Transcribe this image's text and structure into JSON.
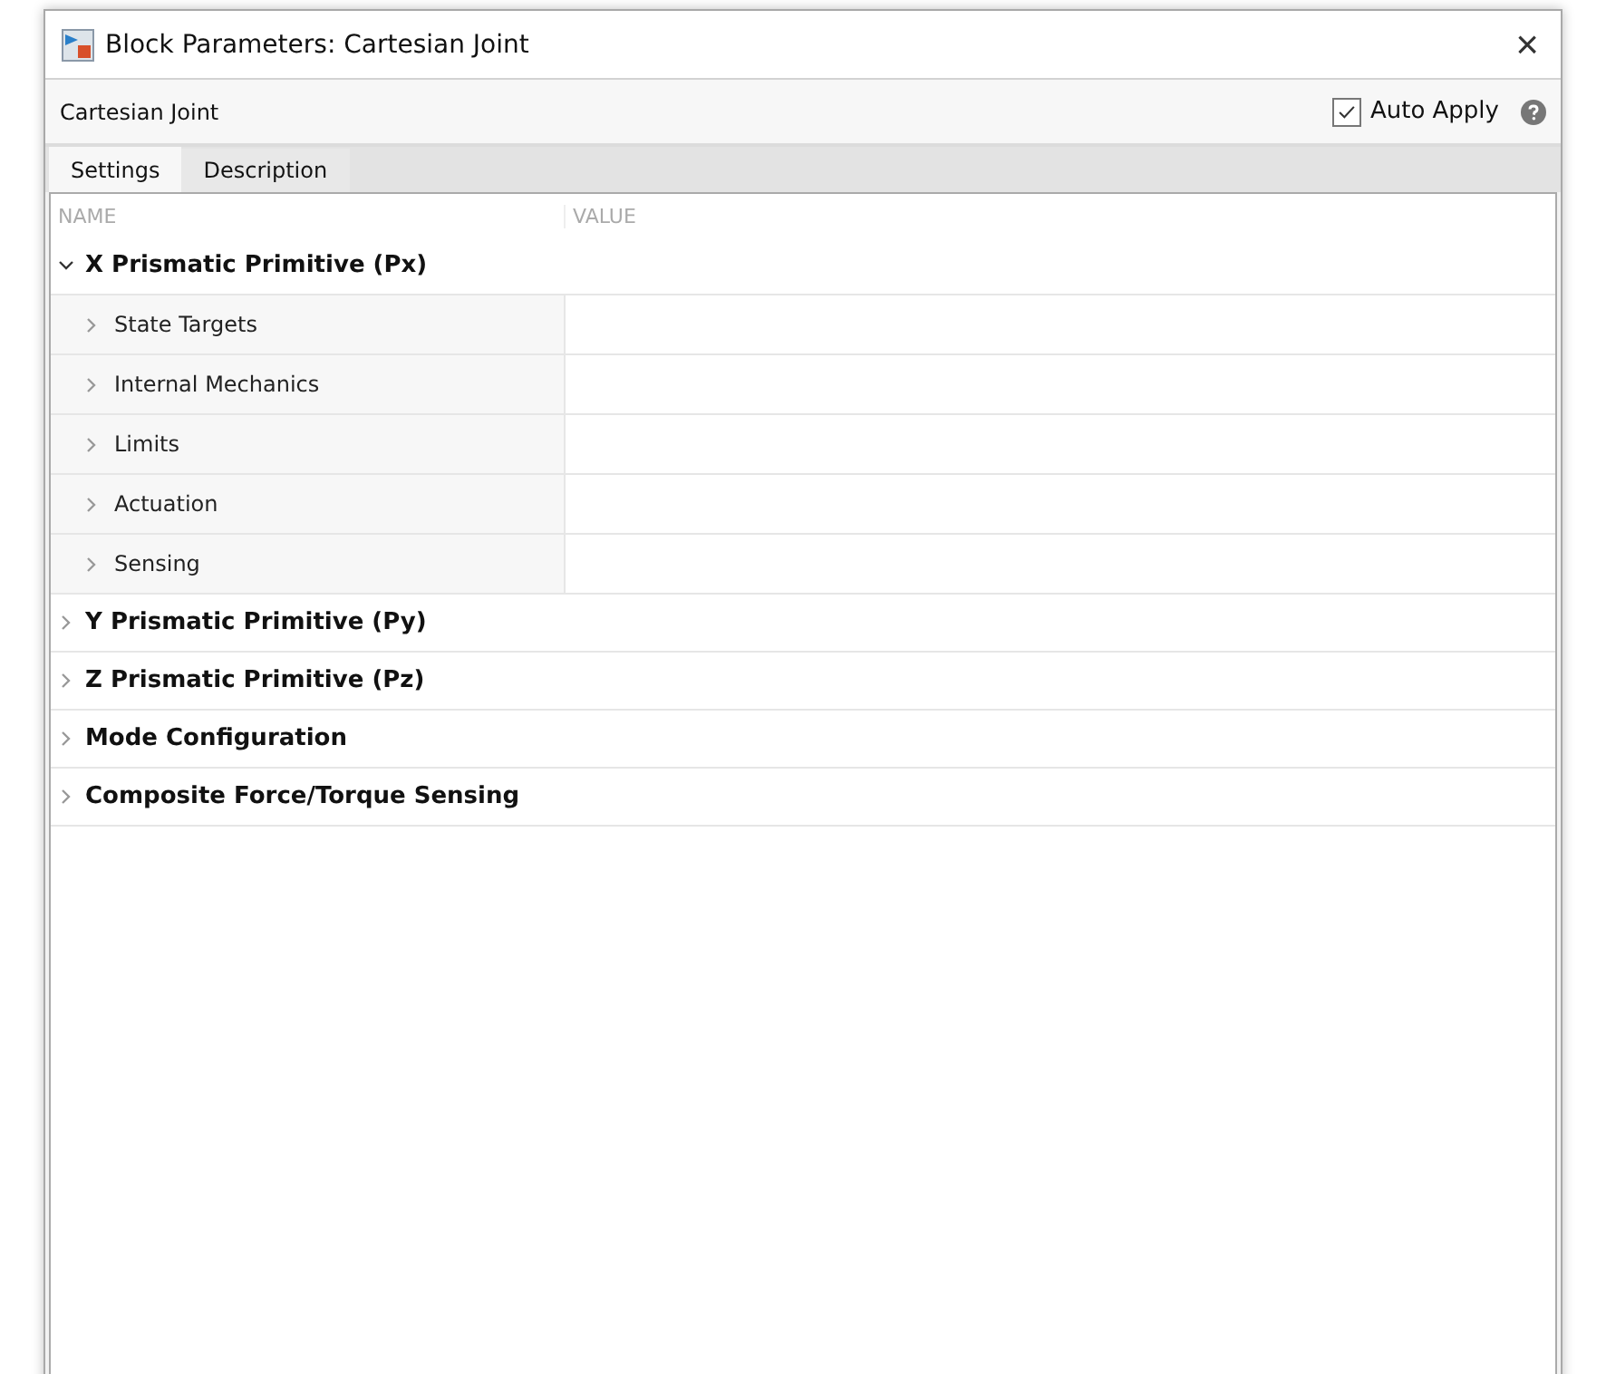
{
  "window": {
    "title": "Block Parameters: Cartesian Joint",
    "close": "×"
  },
  "toolbar": {
    "block_name": "Cartesian Joint",
    "auto_apply": {
      "label": "Auto Apply",
      "checked": true
    }
  },
  "tabs": [
    {
      "label": "Settings",
      "selected": true
    },
    {
      "label": "Description",
      "selected": false
    }
  ],
  "table": {
    "columns": [
      "NAME",
      "VALUE"
    ],
    "groups": [
      {
        "label": "X Prismatic Primitive (Px)",
        "expanded": true,
        "children": [
          {
            "label": "State Targets",
            "expanded": false
          },
          {
            "label": "Internal Mechanics",
            "expanded": false
          },
          {
            "label": "Limits",
            "expanded": false
          },
          {
            "label": "Actuation",
            "expanded": false
          },
          {
            "label": "Sensing",
            "expanded": false
          }
        ]
      },
      {
        "label": "Y Prismatic Primitive (Py)",
        "expanded": false
      },
      {
        "label": "Z Prismatic Primitive (Pz)",
        "expanded": false
      },
      {
        "label": "Mode Configuration",
        "expanded": false
      },
      {
        "label": "Composite Force/Torque Sensing",
        "expanded": false
      }
    ]
  }
}
